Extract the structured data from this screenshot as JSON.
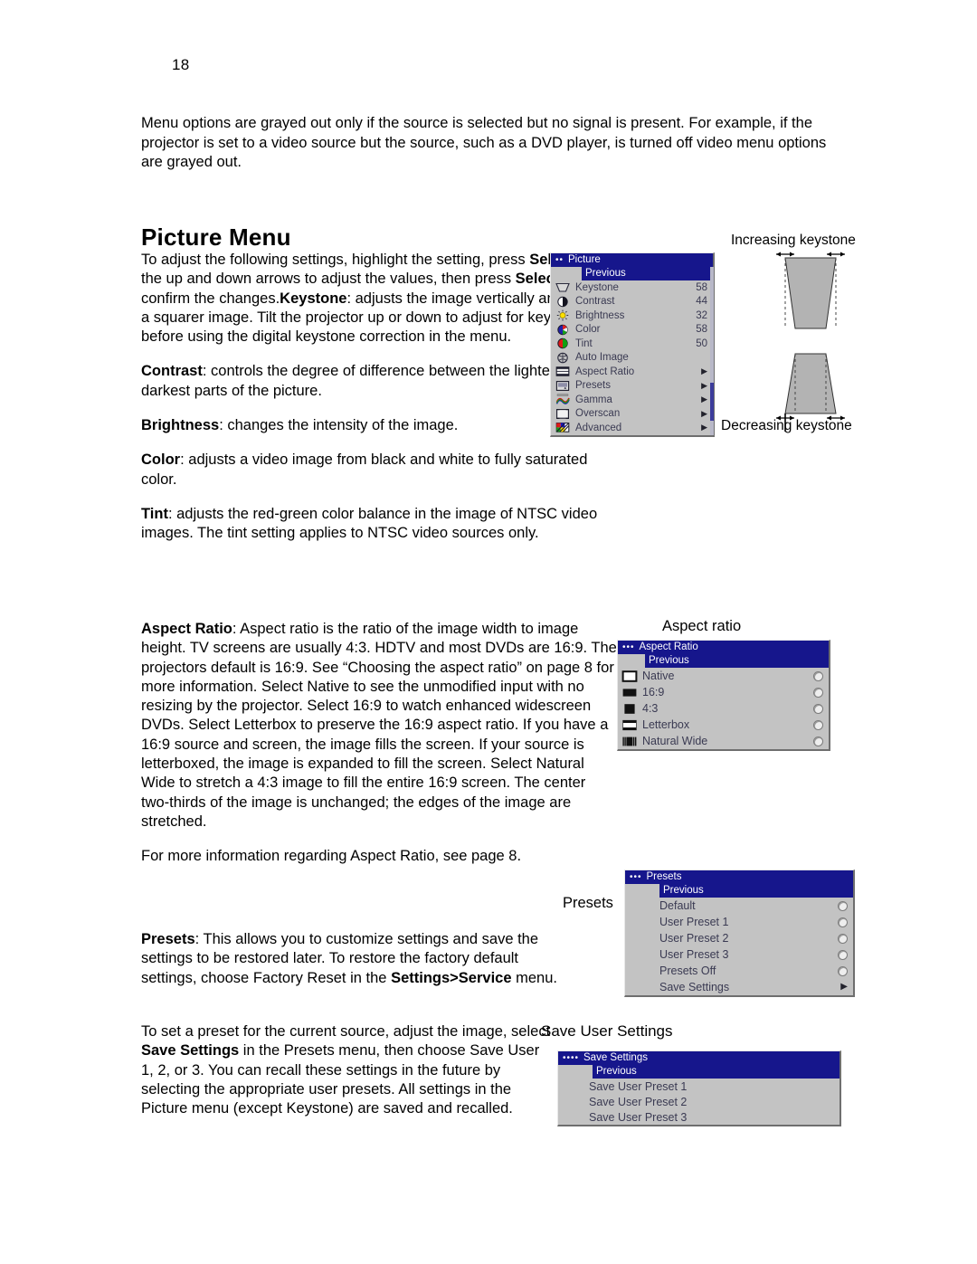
{
  "page": {
    "number": "18",
    "intro": "Menu options are grayed out only if the source is selected but no signal is present. For example, if the projector is set to a video source but the source, such as a DVD player, is turned off video menu options are grayed out.",
    "section_title": "Picture Menu"
  },
  "body": {
    "intro_adjust_1": "To adjust the following settings, highlight the setting, press ",
    "intro_adjust_b1": "Select",
    "intro_adjust_2": ", use the up and down arrows to adjust the values, then press ",
    "intro_adjust_b2": "Select",
    "intro_adjust_3": " to confirm the changes.",
    "keystone_label": "Keystone",
    "keystone_text": ": adjusts the image vertically and makes a squarer image. Tilt the projector up or down to adjust for keystone before using the digital keystone correction in the menu.",
    "contrast_label": "Contrast",
    "contrast_text": ": controls the degree of difference between the lightest and darkest parts of the picture.",
    "brightness_label": "Brightness",
    "brightness_text": ": changes the intensity of the image.",
    "color_label": "Color",
    "color_text": ": adjusts a video image from black and white to fully saturated color.",
    "tint_label": "Tint",
    "tint_text": ": adjusts the red-green color balance in the image of NTSC video images. The tint setting applies to NTSC video sources only.",
    "aspect_label": "Aspect Ratio",
    "aspect_text": ": Aspect ratio is the ratio of the image width to image height. TV screens are usually 4:3. HDTV and most DVDs are 16:9. The projectors default is 16:9. See “Choosing the aspect ratio” on page 8 for more information. Select Native to see the unmodified input with no resizing by the projector. Select 16:9 to watch enhanced widescreen DVDs. Select Letterbox to preserve the 16:9 aspect ratio. If you have a 16:9 source and screen, the image fills the screen. If your source is letterboxed, the image is expanded to fill the screen. Select Natural Wide to stretch a 4:3 image to fill the entire 16:9 screen. The center two-thirds of the image is unchanged; the edges of the image are stretched.",
    "aspect_more": "For more information regarding Aspect Ratio, see page 8.",
    "presets_label": "Presets",
    "presets_text_1": ": This allows you to customize settings and save the settings to be restored later. To restore the factory default settings, choose Factory Reset in the ",
    "presets_bold": "Settings>Service",
    "presets_text_2": " menu.",
    "save_text_1": "To set a preset for the current source, adjust the image, select ",
    "save_bold": "Save Settings",
    "save_text_2": " in the Presets menu, then choose Save User 1, 2, or 3. You can recall these settings in the future by selecting the appropriate user presets. All settings in the Picture menu (except Keystone) are saved and recalled."
  },
  "captions": {
    "increasing_keystone": "Increasing keystone",
    "decreasing_keystone": "Decreasing keystone",
    "aspect_ratio": "Aspect ratio",
    "presets": "Presets",
    "save_user_settings": "Save User Settings"
  },
  "colors": {
    "osd_background": "#c3c3c3",
    "osd_title_bar": "#16168c",
    "osd_title_text": "#ffffff",
    "osd_item_text": "#3a3a52",
    "keystone_fill": "#b3b3b3"
  },
  "picture_menu": {
    "title": "Picture",
    "dots": "••",
    "previous": "Previous",
    "items": [
      {
        "icon": "keystone-icon",
        "label": "Keystone",
        "value": "58"
      },
      {
        "icon": "contrast-icon",
        "label": "Contrast",
        "value": "44"
      },
      {
        "icon": "brightness-icon",
        "label": "Brightness",
        "value": "32"
      },
      {
        "icon": "color-icon",
        "label": "Color",
        "value": "58"
      },
      {
        "icon": "tint-icon",
        "label": "Tint",
        "value": "50"
      },
      {
        "icon": "auto-image-icon",
        "label": "Auto Image",
        "value": ""
      },
      {
        "icon": "aspect-ratio-icon",
        "label": "Aspect Ratio",
        "value": "▶"
      },
      {
        "icon": "presets-icon",
        "label": "Presets",
        "value": "▶"
      },
      {
        "icon": "gamma-icon",
        "label": "Gamma",
        "value": "▶"
      },
      {
        "icon": "overscan-icon",
        "label": "Overscan",
        "value": "▶"
      },
      {
        "icon": "advanced-icon",
        "label": "Advanced",
        "value": "▶"
      }
    ]
  },
  "aspect_menu": {
    "title": "Aspect Ratio",
    "dots": "•••",
    "previous": "Previous",
    "items": [
      {
        "icon": "native-icon",
        "label": "Native",
        "control": "radio"
      },
      {
        "icon": "sixteen-nine-icon",
        "label": "16:9",
        "control": "radio"
      },
      {
        "icon": "four-three-icon",
        "label": "4:3",
        "control": "radio"
      },
      {
        "icon": "letterbox-icon",
        "label": "Letterbox",
        "control": "radio"
      },
      {
        "icon": "natural-wide-icon",
        "label": "Natural Wide",
        "control": "radio"
      }
    ]
  },
  "presets_menu": {
    "title": "Presets",
    "dots": "•••",
    "previous": "Previous",
    "items": [
      {
        "label": "Default",
        "control": "radio"
      },
      {
        "label": "User Preset 1",
        "control": "radio"
      },
      {
        "label": "User Preset 2",
        "control": "radio"
      },
      {
        "label": "User Preset 3",
        "control": "radio"
      },
      {
        "label": "Presets Off",
        "control": "radio"
      },
      {
        "label": "Save Settings",
        "control": "arrow"
      }
    ]
  },
  "save_menu": {
    "title": "Save Settings",
    "dots": "••••",
    "previous": "Previous",
    "items": [
      {
        "label": "Save User Preset 1"
      },
      {
        "label": "Save User Preset 2"
      },
      {
        "label": "Save User Preset 3"
      }
    ]
  }
}
